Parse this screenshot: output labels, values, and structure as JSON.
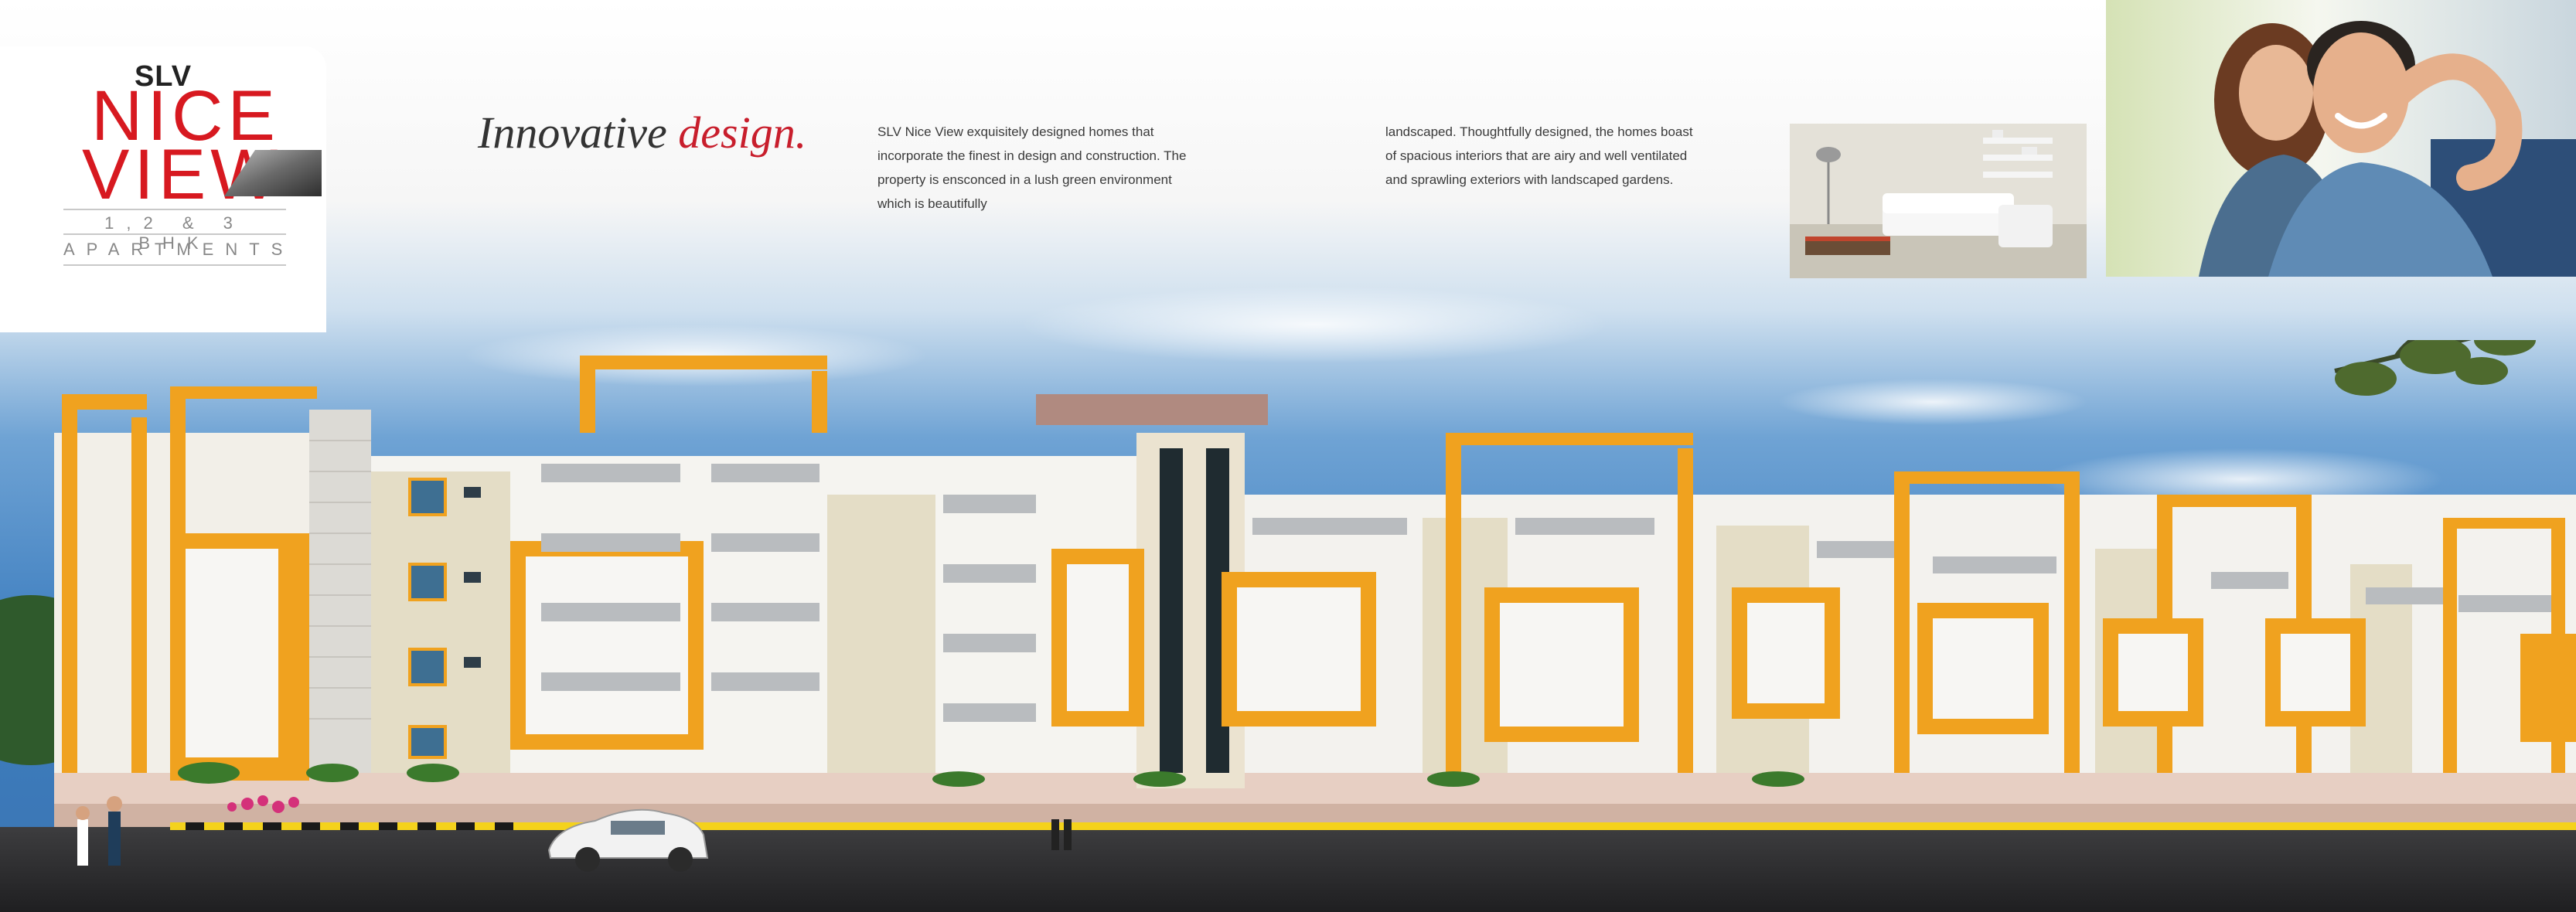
{
  "logo": {
    "brand_top": "SLV",
    "line1": "NICE",
    "line2": "VIEW",
    "bhk": "1,2 & 3 BHK",
    "apartments": "APARTMENTS"
  },
  "heading": {
    "part1": "Innovative",
    "part2": "design."
  },
  "copy": {
    "col1": [
      "SLV Nice View exquisitely designed homes that",
      "incorporate the finest in design and construction. The",
      "property is ensconced in a lush green environment",
      "which is beautifully"
    ],
    "col2": [
      "landscaped. Thoughtfully designed, the homes boast",
      "of spacious interiors that are airy and well ventilated",
      "and sprawling exteriors with landscaped gardens."
    ]
  },
  "colors": {
    "brand_red": "#d71920",
    "accent_orange": "#f2a524",
    "sky_blue": "#5d93c9",
    "facade_white": "#f4f4f2",
    "facade_beige": "#e3dcc4"
  }
}
